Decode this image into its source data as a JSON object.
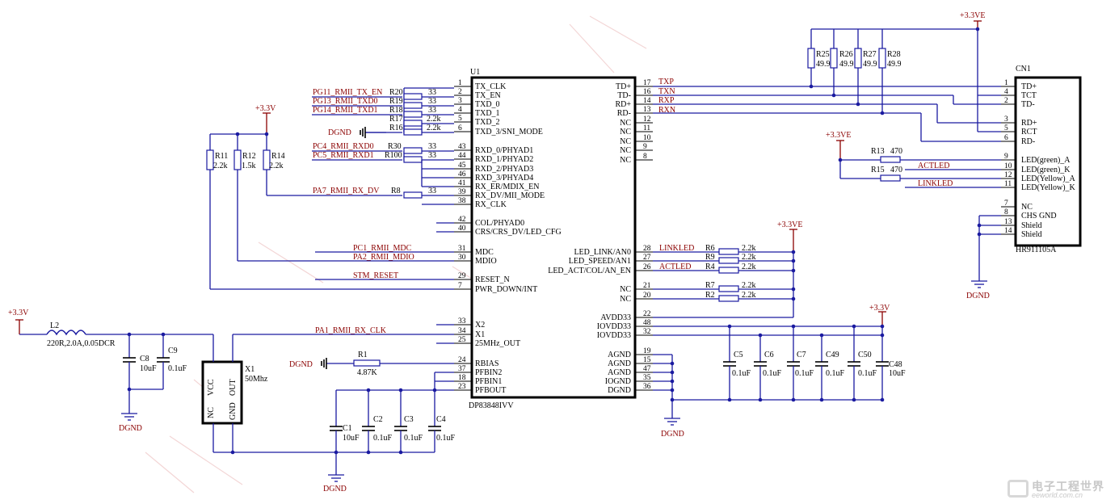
{
  "power": {
    "vcc_l1": "+3.3V",
    "vcc_l2": "+3.3V",
    "vcc_l3": "+3.3VE",
    "vcc_l4": "+3.3VE",
    "vcc_l5": "+3.3VE",
    "vcc_l6": "+3.3V",
    "gnd": "DGND"
  },
  "u1": {
    "ref": "U1",
    "part": "DP83848IVV",
    "left_pins": [
      {
        "num": "1",
        "name": "TX_CLK"
      },
      {
        "num": "2",
        "name": "TX_EN"
      },
      {
        "num": "3",
        "name": "TXD_0"
      },
      {
        "num": "4",
        "name": "TXD_1"
      },
      {
        "num": "5",
        "name": "TXD_2"
      },
      {
        "num": "6",
        "name": "TXD_3/SNI_MODE"
      },
      {
        "num": "43",
        "name": "RXD_0/PHYAD1"
      },
      {
        "num": "44",
        "name": "RXD_1/PHYAD2"
      },
      {
        "num": "45",
        "name": "RXD_2/PHYAD3"
      },
      {
        "num": "46",
        "name": "RXD_3/PHYAD4"
      },
      {
        "num": "41",
        "name": "RX_ER/MDIX_EN"
      },
      {
        "num": "39",
        "name": "RX_DV/MII_MODE"
      },
      {
        "num": "38",
        "name": "RX_CLK"
      },
      {
        "num": "42",
        "name": "COL/PHYAD0"
      },
      {
        "num": "40",
        "name": "CRS/CRS_DV/LED_CFG"
      },
      {
        "num": "31",
        "name": "MDC"
      },
      {
        "num": "30",
        "name": "MDIO"
      },
      {
        "num": "29",
        "name": "RESET_N"
      },
      {
        "num": "7",
        "name": "PWR_DOWN/INT"
      },
      {
        "num": "33",
        "name": "X2"
      },
      {
        "num": "34",
        "name": "X1"
      },
      {
        "num": "25",
        "name": "25MHz_OUT"
      },
      {
        "num": "24",
        "name": "RBIAS"
      },
      {
        "num": "37",
        "name": "PFBIN2"
      },
      {
        "num": "18",
        "name": "PFBIN1"
      },
      {
        "num": "23",
        "name": "PFBOUT"
      }
    ],
    "right_pins": [
      {
        "num": "17",
        "name": "TD+"
      },
      {
        "num": "16",
        "name": "TD-"
      },
      {
        "num": "14",
        "name": "RD+"
      },
      {
        "num": "13",
        "name": "RD-"
      },
      {
        "num": "12",
        "name": "NC"
      },
      {
        "num": "11",
        "name": "NC"
      },
      {
        "num": "10",
        "name": "NC"
      },
      {
        "num": "9",
        "name": "NC"
      },
      {
        "num": "8",
        "name": "NC"
      },
      {
        "num": "28",
        "name": "LED_LINK/AN0"
      },
      {
        "num": "27",
        "name": "LED_SPEED/AN1"
      },
      {
        "num": "26",
        "name": "LED_ACT/COL/AN_EN"
      },
      {
        "num": "21",
        "name": "NC"
      },
      {
        "num": "20",
        "name": "NC"
      },
      {
        "num": "22",
        "name": "AVDD33"
      },
      {
        "num": "48",
        "name": "IOVDD33"
      },
      {
        "num": "32",
        "name": "IOVDD33"
      },
      {
        "num": "19",
        "name": "AGND"
      },
      {
        "num": "15",
        "name": "AGND"
      },
      {
        "num": "47",
        "name": "AGND"
      },
      {
        "num": "35",
        "name": "IOGND"
      },
      {
        "num": "36",
        "name": "DGND"
      }
    ]
  },
  "cn1": {
    "ref": "CN1",
    "part": "HR911105A",
    "pins": [
      {
        "num": "1",
        "name": "TD+"
      },
      {
        "num": "4",
        "name": "TCT"
      },
      {
        "num": "2",
        "name": "TD-"
      },
      {
        "num": "3",
        "name": "RD+"
      },
      {
        "num": "5",
        "name": "RCT"
      },
      {
        "num": "6",
        "name": "RD-"
      },
      {
        "num": "9",
        "name": "LED(green)_A"
      },
      {
        "num": "10",
        "name": "LED(green)_K"
      },
      {
        "num": "12",
        "name": "LED(Yellow)_A"
      },
      {
        "num": "11",
        "name": "LED(Yellow)_K"
      },
      {
        "num": "7",
        "name": "NC"
      },
      {
        "num": "8",
        "name": "CHS GND"
      },
      {
        "num": "13",
        "name": "Shield"
      },
      {
        "num": "14",
        "name": "Shield"
      }
    ]
  },
  "nets": {
    "tx_en": "PG11_RMII_TX_EN",
    "txd0": "PG13_RMII_TXD0",
    "txd1": "PG14_RMII_TXD1",
    "rxd0": "PC4_RMII_RXD0",
    "rxd1": "PC5_RMII_RXD1",
    "rx_dv": "PA7_RMII_RX_DV",
    "mdc": "PC1_RMII_MDC",
    "mdio": "PA2_RMII_MDIO",
    "reset": "STM_RESET",
    "rx_clk": "PA1_RMII_RX_CLK",
    "txp": "TXP",
    "txn": "TXN",
    "rxp": "RXP",
    "rxn": "RXN",
    "linkled": "LINKLED",
    "actled": "ACTLED",
    "linkled_cn": "LINKLED",
    "actled_cn": "ACTLED"
  },
  "resistors": [
    {
      "ref": "R20",
      "value": "33"
    },
    {
      "ref": "R19",
      "value": "33"
    },
    {
      "ref": "R18",
      "value": "33"
    },
    {
      "ref": "R17",
      "value": "2.2k"
    },
    {
      "ref": "R16",
      "value": "2.2k"
    },
    {
      "ref": "R30",
      "value": "33"
    },
    {
      "ref": "R100",
      "value": "33"
    },
    {
      "ref": "R8",
      "value": "33"
    },
    {
      "ref": "R11",
      "value": "2.2k"
    },
    {
      "ref": "R12",
      "value": "1.5k"
    },
    {
      "ref": "R14",
      "value": "2.2k"
    },
    {
      "ref": "R6",
      "value": "2.2k"
    },
    {
      "ref": "R9",
      "value": "2.2k"
    },
    {
      "ref": "R4",
      "value": "2.2k"
    },
    {
      "ref": "R7",
      "value": "2.2k"
    },
    {
      "ref": "R2",
      "value": "2.2k"
    },
    {
      "ref": "R1",
      "value": "4.87K"
    },
    {
      "ref": "R25",
      "value": "49.9"
    },
    {
      "ref": "R26",
      "value": "49.9"
    },
    {
      "ref": "R27",
      "value": "49.9"
    },
    {
      "ref": "R28",
      "value": "49.9"
    },
    {
      "ref": "R13",
      "value": "470"
    },
    {
      "ref": "R15",
      "value": "470"
    }
  ],
  "capacitors": [
    {
      "ref": "C8",
      "value": "10uF"
    },
    {
      "ref": "C9",
      "value": "0.1uF"
    },
    {
      "ref": "C1",
      "value": "10uF"
    },
    {
      "ref": "C2",
      "value": "0.1uF"
    },
    {
      "ref": "C3",
      "value": "0.1uF"
    },
    {
      "ref": "C4",
      "value": "0.1uF"
    },
    {
      "ref": "C5",
      "value": "0.1uF"
    },
    {
      "ref": "C6",
      "value": "0.1uF"
    },
    {
      "ref": "C7",
      "value": "0.1uF"
    },
    {
      "ref": "C49",
      "value": "0.1uF"
    },
    {
      "ref": "C50",
      "value": "0.1uF"
    },
    {
      "ref": "C48",
      "value": "10uF"
    }
  ],
  "inductor": {
    "ref": "L2",
    "value": "220R,2.0A,0.05DCR"
  },
  "crystal": {
    "ref": "X1",
    "value": "50Mhz",
    "pins": [
      "VCC",
      "OUT",
      "NC",
      "GND"
    ]
  },
  "logo": {
    "cn": "电子工程世界",
    "en": "eeworld.com.cn"
  }
}
